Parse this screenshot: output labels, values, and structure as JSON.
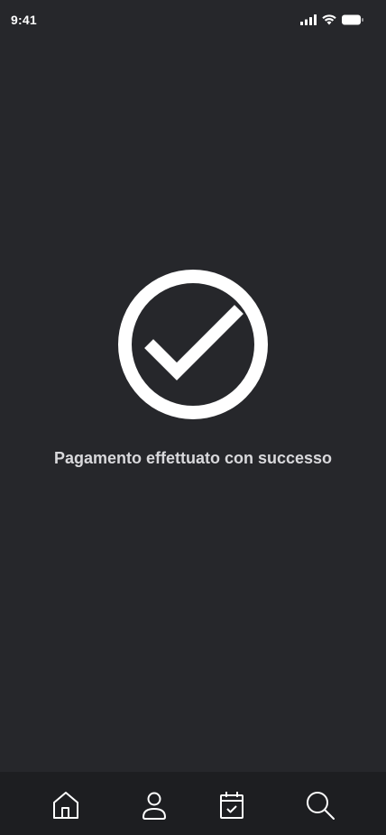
{
  "status_bar": {
    "time": "9:41",
    "icons": [
      "cellular-signal-icon",
      "wifi-icon",
      "battery-icon"
    ]
  },
  "main": {
    "icon": "check-circle-icon",
    "message": "Pagamento effettuato con successo"
  },
  "tab_bar": {
    "items": [
      {
        "icon": "home-icon"
      },
      {
        "icon": "user-icon"
      },
      {
        "icon": "calendar-check-icon"
      },
      {
        "icon": "search-icon"
      }
    ]
  },
  "colors": {
    "background": "#26272b",
    "tab_bar": "#1d1e21",
    "text": "#d9d9dc",
    "icon": "#ffffff"
  }
}
